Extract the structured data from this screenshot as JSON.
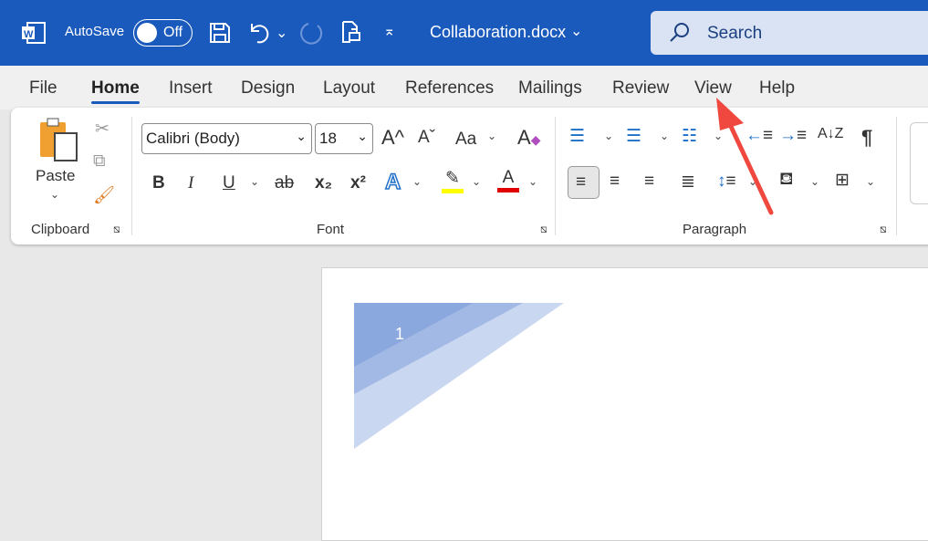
{
  "titlebar": {
    "app_icon": "word-icon",
    "autosave_label": "AutoSave",
    "autosave_state": "Off",
    "filename": "Collaboration.docx",
    "search_placeholder": "Search",
    "color": "#1b5abd"
  },
  "tabs": [
    {
      "label": "File"
    },
    {
      "label": "Home",
      "active": true
    },
    {
      "label": "Insert"
    },
    {
      "label": "Design"
    },
    {
      "label": "Layout"
    },
    {
      "label": "References"
    },
    {
      "label": "Mailings"
    },
    {
      "label": "Review"
    },
    {
      "label": "View"
    },
    {
      "label": "Help"
    }
  ],
  "ribbon": {
    "clipboard": {
      "paste_label": "Paste",
      "group_label": "Clipboard"
    },
    "font": {
      "font_name": "Calibri (Body)",
      "font_size": "18",
      "group_label": "Font",
      "bold": "B",
      "italic": "I",
      "underline": "U",
      "strike": "ab",
      "subscript": "x₂",
      "superscript": "x²",
      "grow": "A^",
      "shrink": "Aˇ",
      "case": "Aa",
      "text_effects": "A",
      "font_color": "A",
      "highlight_color": "#ffff00",
      "font_color_value": "#e00000"
    },
    "paragraph": {
      "group_label": "Paragraph",
      "sort": "A↓Z",
      "pilcrow": "¶"
    }
  },
  "document": {
    "page_number": "1"
  },
  "annotation": {
    "arrow_color": "#f0483e"
  }
}
